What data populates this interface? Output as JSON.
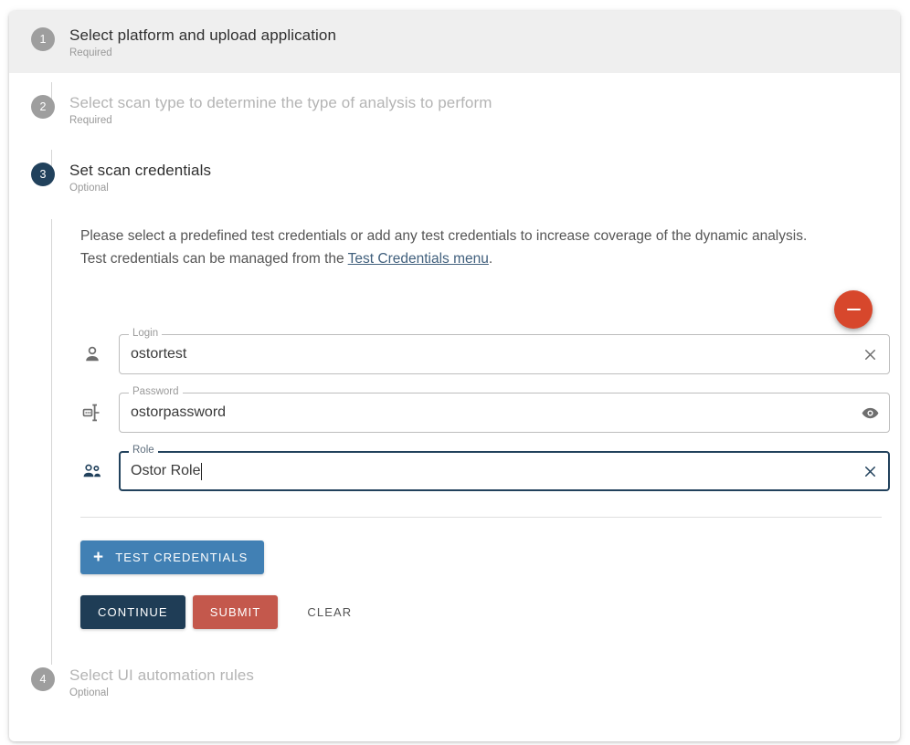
{
  "steps": [
    {
      "number": "1",
      "title": "Select platform and upload application",
      "subtitle": "Required",
      "state": "completed-highlighted"
    },
    {
      "number": "2",
      "title": "Select scan type to determine the type of analysis to perform",
      "subtitle": "Required",
      "state": "disabled"
    },
    {
      "number": "3",
      "title": "Set scan credentials",
      "subtitle": "Optional",
      "state": "active"
    },
    {
      "number": "4",
      "title": "Select UI automation rules",
      "subtitle": "Optional",
      "state": "disabled"
    }
  ],
  "intro": {
    "line1": "Please select a predefined test credentials or add any test credentials to increase coverage of the dynamic analysis.",
    "line2_prefix": "Test credentials can be managed from the ",
    "link_text": "Test Credentials menu",
    "line2_suffix": "."
  },
  "remove_button": {
    "icon": "minus-icon",
    "aria_label": "Remove credentials"
  },
  "form": {
    "fields": [
      {
        "label": "Login",
        "value": "ostortest",
        "placeholder": "Login",
        "lead_icon": "person-icon",
        "action_icon": "close-icon",
        "focused": false
      },
      {
        "label": "Password",
        "value": "ostorpassword",
        "placeholder": "Password",
        "lead_icon": "password-key-icon",
        "action_icon": "eye-icon",
        "focused": false
      },
      {
        "label": "Role",
        "value": "Ostor Role",
        "placeholder": "Role",
        "lead_icon": "people-icon",
        "action_icon": "close-icon",
        "focused": true
      }
    ]
  },
  "buttons": {
    "test_credentials": "TEST CREDENTIALS",
    "test_credentials_icon": "plus-icon",
    "continue": "CONTINUE",
    "submit": "SUBMIT",
    "clear": "CLEAR"
  },
  "colors": {
    "navy": "#1f3d56",
    "blue": "#4180b4",
    "red": "#c4584c",
    "fab_red": "#d7472c",
    "step_gray": "#9e9e9e",
    "highlight_bg": "#efefef",
    "link": "#41607d"
  }
}
